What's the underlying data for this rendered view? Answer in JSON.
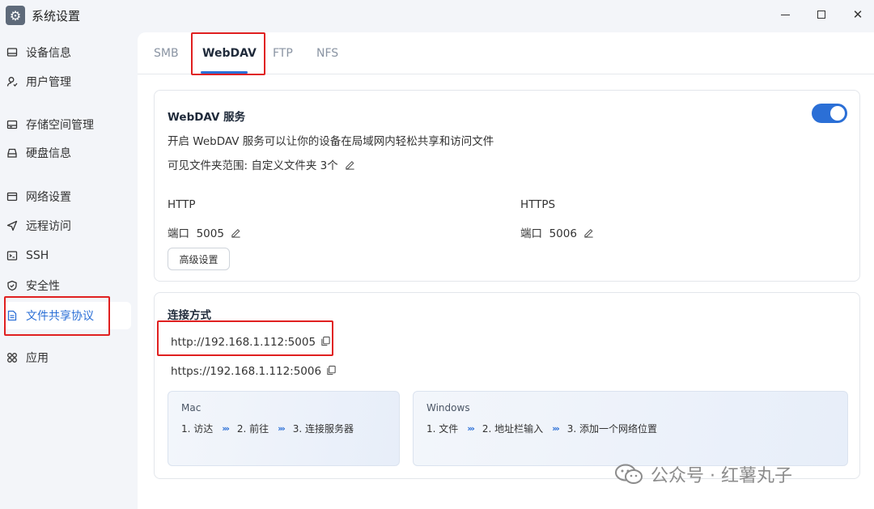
{
  "window": {
    "title": "系统设置"
  },
  "sidebar": {
    "items": [
      {
        "label": "设备信息",
        "icon": "monitor-icon"
      },
      {
        "label": "用户管理",
        "icon": "user-icon"
      },
      {
        "label": "存储空间管理",
        "icon": "storage-icon"
      },
      {
        "label": "硬盘信息",
        "icon": "disk-icon"
      },
      {
        "label": "网络设置",
        "icon": "network-icon"
      },
      {
        "label": "远程访问",
        "icon": "send-icon"
      },
      {
        "label": "SSH",
        "icon": "terminal-icon"
      },
      {
        "label": "安全性",
        "icon": "shield-icon"
      },
      {
        "label": "文件共享协议",
        "icon": "document-icon",
        "active": true
      },
      {
        "label": "应用",
        "icon": "apps-icon"
      }
    ]
  },
  "tabs": [
    {
      "label": "SMB"
    },
    {
      "label": "WebDAV",
      "active": true
    },
    {
      "label": "FTP"
    },
    {
      "label": "NFS"
    }
  ],
  "service": {
    "title": "WebDAV 服务",
    "enabled": true,
    "description": "开启 WebDAV 服务可以让你的设备在局域网内轻松共享和访问文件",
    "visible_scope": "可见文件夹范围: 自定义文件夹 3个",
    "http": {
      "label": "HTTP",
      "port_label": "端口",
      "port": "5005"
    },
    "https": {
      "label": "HTTPS",
      "port_label": "端口",
      "port": "5006"
    },
    "advanced_button": "高级设置"
  },
  "connection": {
    "title": "连接方式",
    "http_url": "http://192.168.1.112:5005",
    "https_url": "https://192.168.1.112:5006",
    "mac": {
      "title": "Mac",
      "steps": [
        "1. 访达",
        "2. 前往",
        "3. 连接服务器"
      ]
    },
    "windows": {
      "title": "Windows",
      "steps": [
        "1. 文件",
        "2. 地址栏输入",
        "3. 添加一个网络位置"
      ]
    }
  },
  "watermark": {
    "text": "公众号 · 红薯丸子"
  },
  "colors": {
    "accent": "#2b6fd6",
    "highlight": "#e02020"
  }
}
